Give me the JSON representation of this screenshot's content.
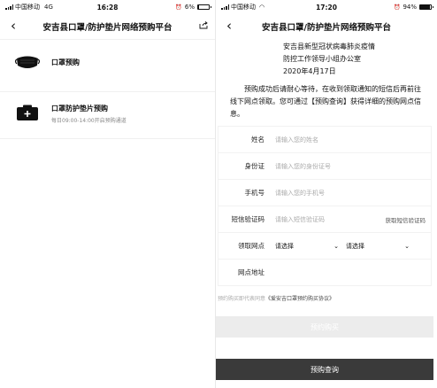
{
  "left": {
    "status": {
      "carrier": "中国移动",
      "network": "4G",
      "time": "16:28",
      "battery": "6%",
      "battery_level": 0.06
    },
    "nav": {
      "title": "安吉县口罩/防护垫片网络预购平台"
    },
    "items": [
      {
        "label": "口罩预购",
        "subtitle": ""
      },
      {
        "label": "口罩防护垫片预购",
        "subtitle": "每日09:00-14:00开启预购通道"
      }
    ]
  },
  "right": {
    "status": {
      "carrier": "中国移动",
      "time": "17:20",
      "battery": "94%",
      "battery_level": 0.94
    },
    "nav": {
      "title": "安吉县口罩/防护垫片网络预购平台"
    },
    "issuer": [
      "安吉县新型冠状病毒肺炎疫情",
      "防控工作领导小组办公室",
      "2020年4月17日"
    ],
    "notice": "预购成功后请耐心等待，在收到领取通知的短信后再前往线下网点领取。您可通过【预购查询】获得详细的预购网点信息。",
    "form": {
      "name_label": "姓名",
      "name_placeholder": "请输入您的姓名",
      "id_label": "身份证",
      "id_placeholder": "请输入您的身份证号",
      "phone_label": "手机号",
      "phone_placeholder": "请输入您的手机号",
      "code_label": "短信验证码",
      "code_placeholder": "请输入短信验证码",
      "get_code": "获取短信验证码",
      "pickup_label": "领取网点",
      "select1": "请选择",
      "select2": "请选择",
      "address_label": "网点地址"
    },
    "agreement": {
      "prefix": "预约购买即代表同意",
      "link": "《爱安吉口罩预约购买协议》"
    },
    "buy_button": "预约购买",
    "query_button": "预购查询"
  }
}
